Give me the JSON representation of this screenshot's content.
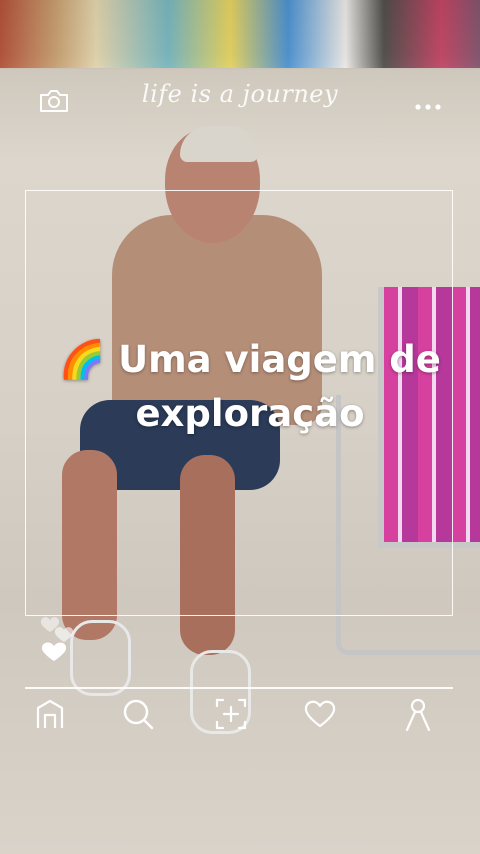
{
  "overlay": {
    "tagline": "life is a journey",
    "headline_emoji": "🌈",
    "headline_line1": "Uma viagem de",
    "headline_line2": "exploração"
  },
  "icons": {
    "top_left": "camera-icon",
    "top_right": "more-dots-icon",
    "side": "hearts-icon"
  },
  "nav": {
    "items": [
      {
        "icon": "home-icon"
      },
      {
        "icon": "search-icon"
      },
      {
        "icon": "add-icon"
      },
      {
        "icon": "heart-icon"
      },
      {
        "icon": "profile-icon"
      }
    ]
  },
  "colors": {
    "overlay": "#ffffff"
  }
}
